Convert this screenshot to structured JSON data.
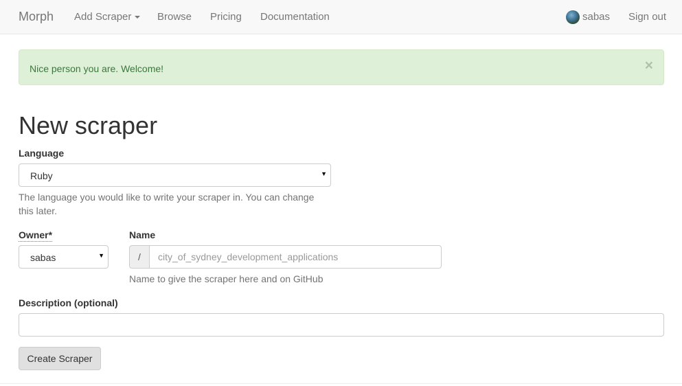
{
  "navbar": {
    "brand": "Morph",
    "items": [
      {
        "label": "Add Scraper",
        "dropdown": true
      },
      {
        "label": "Browse"
      },
      {
        "label": "Pricing"
      },
      {
        "label": "Documentation"
      }
    ],
    "user": {
      "name": "sabas",
      "avatar_icon": "user-avatar"
    },
    "sign_out": "Sign out"
  },
  "alert": {
    "message": "Nice person you are. Welcome!",
    "close_glyph": "×",
    "color": "#3c763d",
    "background": "#dff0d8"
  },
  "page": {
    "title": "New scraper"
  },
  "form": {
    "language": {
      "label": "Language",
      "value": "Ruby",
      "help": "The language you would like to write your scraper in. You can change this later."
    },
    "owner": {
      "label": "Owner*",
      "value": "sabas"
    },
    "name": {
      "label": "Name",
      "prefix": "/",
      "value": "",
      "placeholder": "city_of_sydney_development_applications",
      "help": "Name to give the scraper here and on GitHub"
    },
    "description": {
      "label": "Description (optional)",
      "value": "",
      "placeholder": ""
    },
    "submit_label": "Create Scraper"
  }
}
